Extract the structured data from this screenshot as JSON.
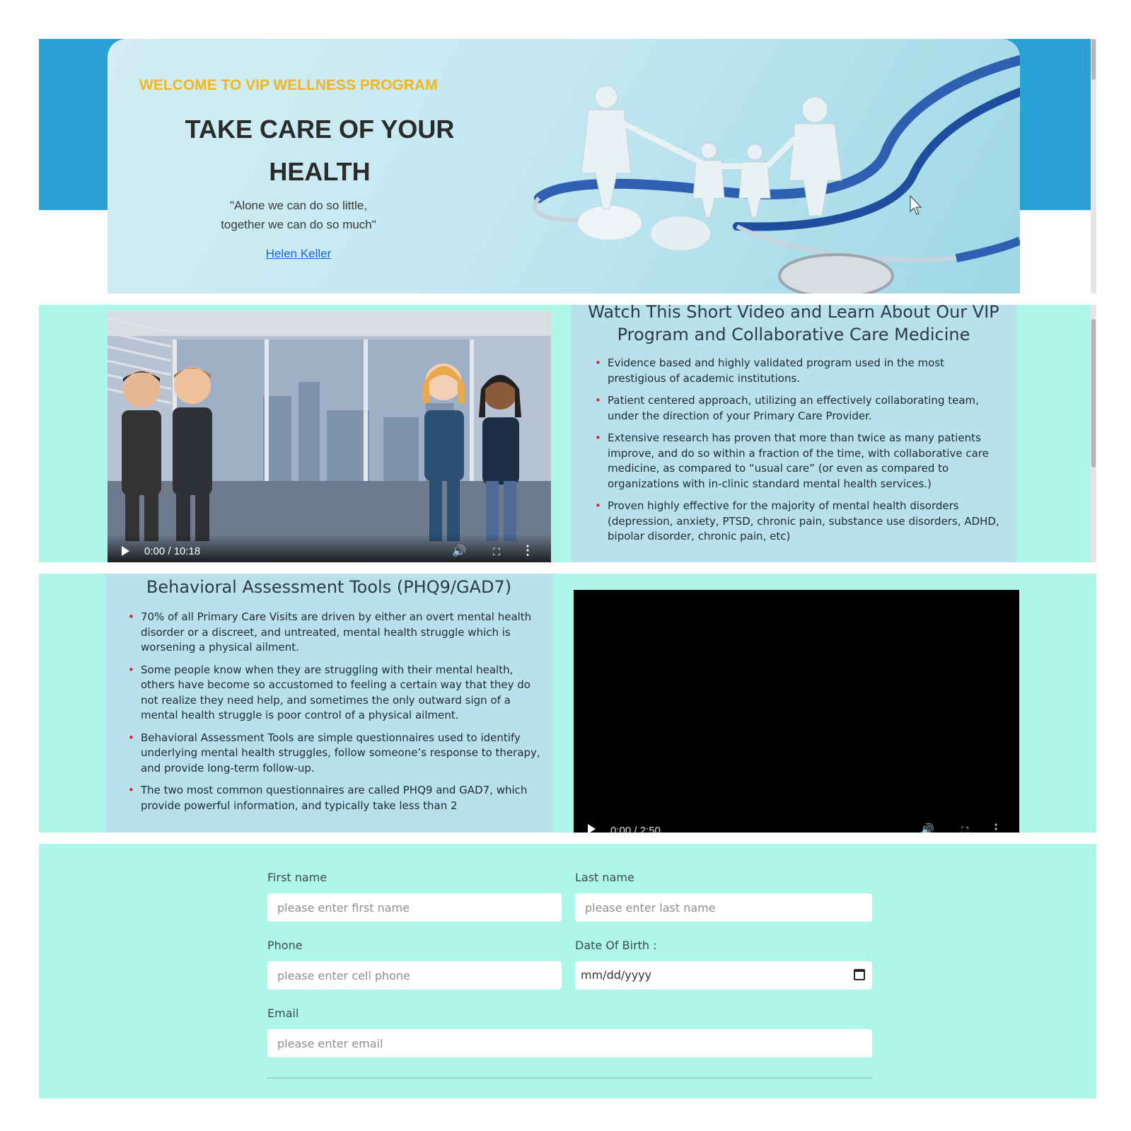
{
  "hero": {
    "welcome": "WELCOME TO VIP WELLNESS PROGRAM",
    "title_line1": "TAKE CARE OF YOUR",
    "title_line2": "HEALTH",
    "quote_line1": "\"Alone we can do so little,",
    "quote_line2": "together we can do so much\"",
    "author": "Helen Keller"
  },
  "video1": {
    "time": "0:00 / 10:18"
  },
  "panel1": {
    "title_line1": "Watch This Short Video and Learn About Our VIP",
    "title_line2": "Program and Collaborative Care Medicine",
    "items": [
      "Evidence based and highly validated program used in the most prestigious of academic institutions.",
      "Patient centered approach, utilizing an effectively collaborating team, under the direction of your Primary Care Provider.",
      "Extensive research has proven that more than twice as many patients improve, and do so within a fraction of the time, with collaborative care medicine, as compared to “usual care” (or even as compared to organizations with in-clinic standard mental health services.)",
      "Proven highly effective for the majority of mental health disorders (depression, anxiety, PTSD, chronic pain, substance use disorders, ADHD, bipolar disorder, chronic pain, etc)"
    ]
  },
  "panel2": {
    "title": "Behavioral Assessment Tools (PHQ9/GAD7)",
    "items": [
      "70% of all Primary Care Visits are driven by either an overt mental health disorder or a discreet, and untreated, mental health struggle which is worsening a physical ailment.",
      "Some people know when they are struggling with their mental health, others have become so accustomed to feeling a certain way that they do not realize they need help, and sometimes the only outward sign of a mental health struggle is poor control of a physical ailment.",
      "Behavioral Assessment Tools are simple questionnaires used to identify underlying mental health struggles, follow someone’s response to therapy, and provide long-term follow-up.",
      "The two most common questionnaires are called PHQ9 and GAD7, which provide powerful information, and typically take less than 2"
    ]
  },
  "video2": {
    "time": "0:00 / 2:50"
  },
  "form": {
    "first_name_label": "First name",
    "first_name_placeholder": "please enter first name",
    "last_name_label": "Last name",
    "last_name_placeholder": "please enter last name",
    "phone_label": "Phone",
    "phone_placeholder": "please enter cell phone",
    "dob_label": "Date Of Birth :",
    "dob_value": "mm/dd/yyyy",
    "email_label": "Email",
    "email_placeholder": "please enter email"
  },
  "icons": {
    "play": "play-icon",
    "volume": "volume-icon",
    "fullscreen": "fullscreen-icon",
    "more": "more-options-icon",
    "calendar": "calendar-icon",
    "cursor": "mouse-cursor-icon"
  },
  "colors": {
    "hero_blue": "#2aa1d6",
    "welcome_yellow": "#f2b620",
    "mint_background": "#aef6ea",
    "panel_blue": "#b9e1ec",
    "bullet_red": "#d61f2c",
    "link_blue": "#1a66d6"
  }
}
